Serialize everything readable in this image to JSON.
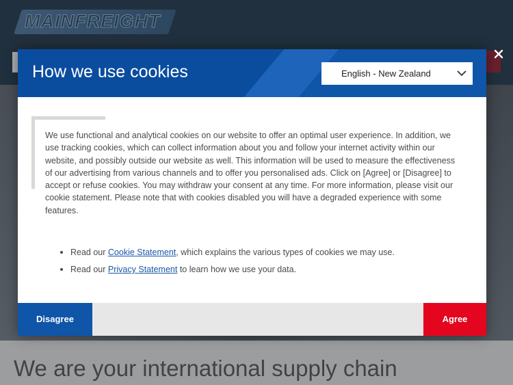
{
  "background": {
    "logo_text": "MAINFREIGHT",
    "headline": "We are your international supply chain"
  },
  "dialog": {
    "title": "How we use cookies",
    "language": {
      "selected": "English - New Zealand"
    },
    "body": "We use functional and analytical cookies on our website to offer an optimal user experience. In addition, we use tracking cookies, which can collect information about you and follow your internet activity within our website, and possibly outside our website as well. This information will be used to measure the effectiveness of our advertising from various channels and to offer you personalised ads. Click on [Agree] or [Disagree] to accept or refuse cookies. You may withdraw your consent at any time. For more information, please visit our cookie statement. Please note that with cookies disabled you will have a degraded experience with some features.",
    "bullets": [
      {
        "prefix": "Read our ",
        "link": "Cookie Statement",
        "suffix": ", which explains the various types of cookies we may use."
      },
      {
        "prefix": "Read our ",
        "link": "Privacy Statement",
        "suffix": " to learn how we use your data."
      }
    ],
    "disagree_label": "Disagree",
    "agree_label": "Agree"
  },
  "icons": {
    "close": "close-icon",
    "chevron": "chevron-down-icon"
  },
  "colors": {
    "header_blue": "#0f55a8",
    "agree_red": "#e3061e",
    "link_blue": "#1a56a8"
  }
}
